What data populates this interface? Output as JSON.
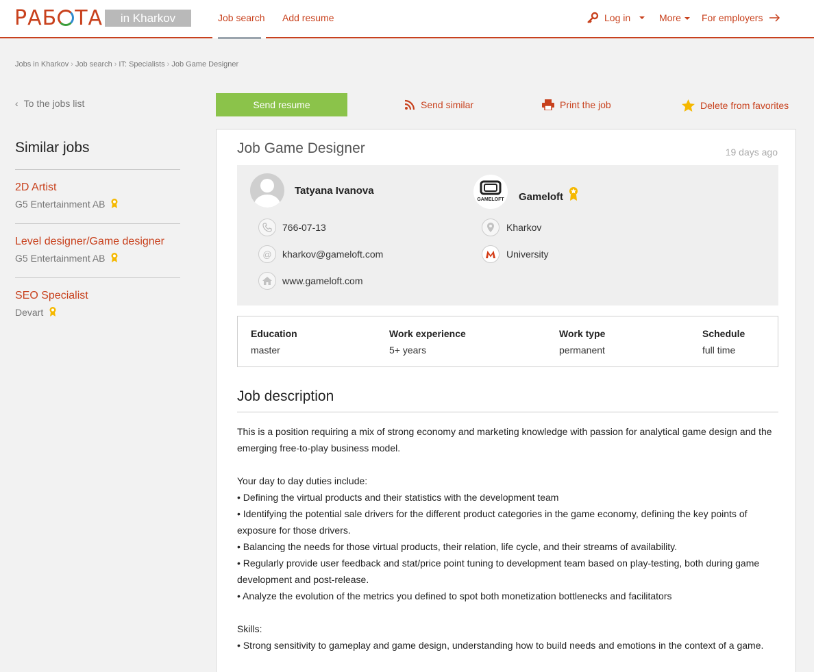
{
  "header": {
    "logo_text_1": "РАБ",
    "logo_text_2": "ТА",
    "city": "in Kharkov",
    "nav": {
      "job_search": "Job search",
      "add_resume": "Add resume",
      "log_in": "Log in",
      "more": "More",
      "for_employers": "For employers"
    }
  },
  "breadcrumb": [
    "Jobs in Kharkov",
    "Job search",
    "IT: Specialists",
    "Job Game Designer"
  ],
  "sidebar": {
    "back_link": "To the jobs list",
    "similar_title": "Similar jobs",
    "jobs": [
      {
        "title": "2D Artist",
        "company": "G5 Entertainment AB"
      },
      {
        "title": "Level designer/Game designer",
        "company": "G5 Entertainment AB"
      },
      {
        "title": "SEO Specialist",
        "company": "Devart"
      }
    ]
  },
  "actions": {
    "send_resume": "Send resume",
    "send_similar": "Send similar",
    "print_job": "Print the job",
    "delete_favorites": "Delete from favorites"
  },
  "job": {
    "title": "Job Game Designer",
    "posted": "19 days ago",
    "contact": {
      "name": "Tatyana Ivanova",
      "phone": "766-07-13",
      "email": "kharkov@gameloft.com",
      "website": "www.gameloft.com"
    },
    "company": {
      "name": "Gameloft",
      "logo_text": "GAMELOFT",
      "city": "Kharkov",
      "metro": "University"
    },
    "properties": [
      {
        "label": "Education",
        "value": "master"
      },
      {
        "label": "Work experience",
        "value": "5+ years"
      },
      {
        "label": "Work type",
        "value": "permanent"
      },
      {
        "label": "Schedule",
        "value": "full time"
      }
    ],
    "description_title": "Job description",
    "description": {
      "intro": "This is a position requiring a mix of strong economy and marketing knowledge with passion for analytical game design and the emerging free-to-play business model.",
      "duties_heading": "Your day to day duties include:",
      "duties": [
        "• Defining the virtual products and their statistics with the development team",
        "• Identifying the potential sale drivers for the different product categories in the game economy, defining the key points of exposure for those drivers.",
        "• Balancing the needs for those virtual products, their relation, life cycle, and their streams of availability.",
        "• Regularly provide user feedback and stat/price point tuning to development team based on play-testing, both during game development and post-release.",
        "• Analyze the evolution of the metrics you defined to spot both monetization bottlenecks and facilitators"
      ],
      "skills_heading": "Skills:",
      "skills": [
        "• Strong sensitivity to gameplay and game design, understanding how to build needs and emotions in the context of a game."
      ]
    }
  },
  "colors": {
    "brand": "#c8411d",
    "accent_green": "#8bc34a",
    "award_gold": "#f5b800"
  }
}
